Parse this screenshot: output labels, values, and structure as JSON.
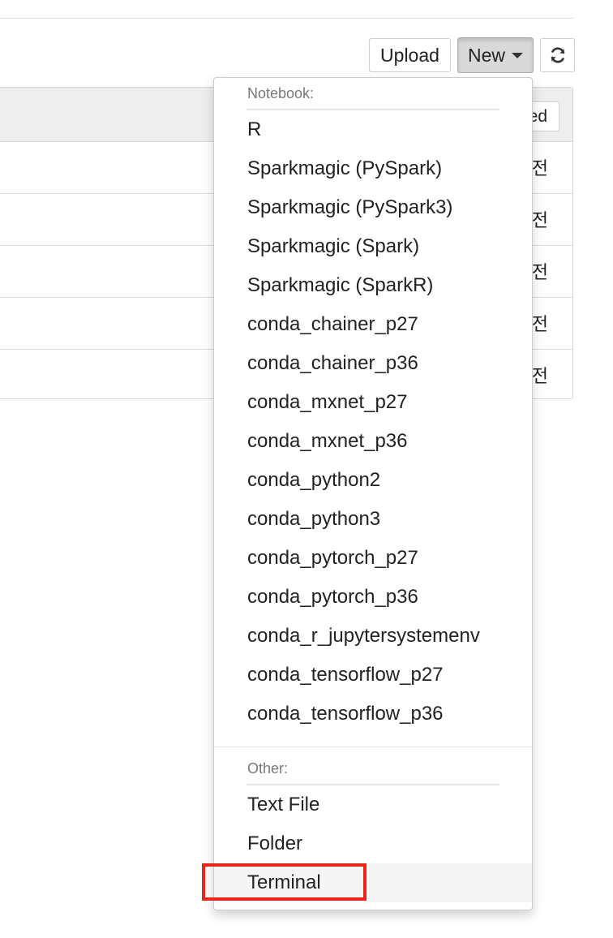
{
  "toolbar": {
    "upload_label": "Upload",
    "new_label": "New",
    "refresh_icon": "refresh-icon"
  },
  "file_list": {
    "sort_label": "Last Modified",
    "rows": [
      {
        "modified": "전"
      },
      {
        "modified": "전"
      },
      {
        "modified": "전"
      },
      {
        "modified": "전"
      },
      {
        "modified": "전"
      }
    ]
  },
  "dropdown": {
    "notebook_header": "Notebook:",
    "notebook_items": [
      "R",
      "Sparkmagic (PySpark)",
      "Sparkmagic (PySpark3)",
      "Sparkmagic (Spark)",
      "Sparkmagic (SparkR)",
      "conda_chainer_p27",
      "conda_chainer_p36",
      "conda_mxnet_p27",
      "conda_mxnet_p36",
      "conda_python2",
      "conda_python3",
      "conda_pytorch_p27",
      "conda_pytorch_p36",
      "conda_r_jupytersystemenv",
      "conda_tensorflow_p27",
      "conda_tensorflow_p36"
    ],
    "other_header": "Other:",
    "other_items": [
      "Text File",
      "Folder",
      "Terminal"
    ],
    "highlighted_item": "Terminal"
  },
  "colors": {
    "highlight_border": "#e8261d",
    "active_button_bg": "#d9d9d9"
  }
}
